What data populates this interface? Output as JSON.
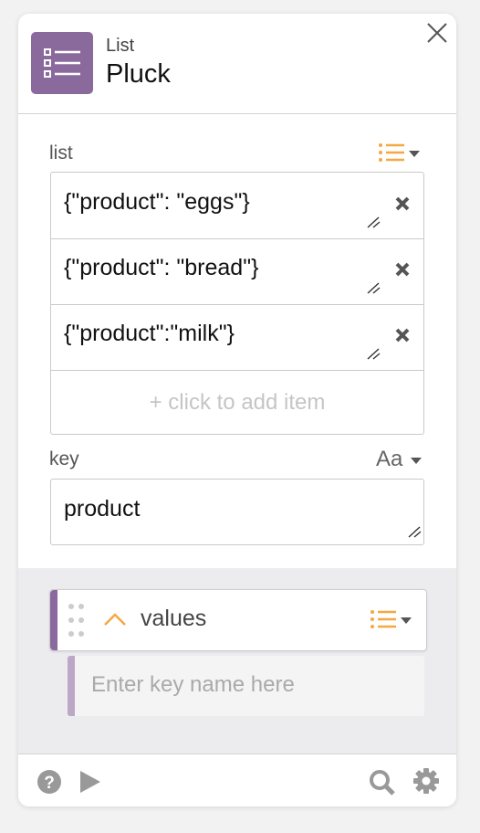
{
  "header": {
    "subtitle": "List",
    "title": "Pluck"
  },
  "list_field": {
    "label": "list",
    "items": [
      {
        "value": "{\"product\": \"eggs\"}"
      },
      {
        "value": "{\"product\": \"bread\"}"
      },
      {
        "value": "{\"product\":\"milk\"}"
      }
    ],
    "add_item_label": "+ click to add item"
  },
  "key_field": {
    "label": "key",
    "type_label": "Aa",
    "value": "product"
  },
  "output": {
    "name": "values",
    "sub_placeholder": "Enter key name here"
  },
  "colors": {
    "accent": "#8a6a9d",
    "accent_light": "#bda7c6",
    "orange": "#f5a742"
  },
  "icons": {
    "header": "list-icon",
    "close": "close-icon",
    "list_toggle": "list-type-icon",
    "remove": "remove-x-icon",
    "help": "help-icon",
    "run": "play-icon",
    "search": "search-icon",
    "settings": "gear-icon"
  }
}
